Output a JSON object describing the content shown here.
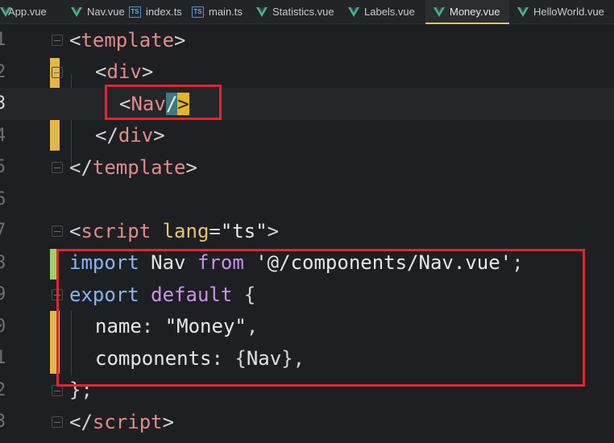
{
  "tabs": [
    {
      "label": "App.vue",
      "icon": "vue-icon",
      "active": false
    },
    {
      "label": "Nav.vue",
      "icon": "vue-icon",
      "active": false
    },
    {
      "label": "index.ts",
      "icon": "ts-icon",
      "active": false
    },
    {
      "label": "main.ts",
      "icon": "ts-icon",
      "active": false
    },
    {
      "label": "Statistics.vue",
      "icon": "vue-icon",
      "active": false
    },
    {
      "label": "Labels.vue",
      "icon": "vue-icon",
      "active": false
    },
    {
      "label": "Money.vue",
      "icon": "vue-icon",
      "active": true
    },
    {
      "label": "HelloWorld.vue",
      "icon": "vue-icon",
      "active": false
    }
  ],
  "ts_badge": "TS",
  "line_numbers": [
    "1",
    "2",
    "3",
    "4",
    "5",
    "6",
    "7",
    "8",
    "9",
    "0",
    "1",
    "2",
    "3"
  ],
  "code": {
    "l1": {
      "open": "<",
      "tag": "template",
      "close": ">"
    },
    "l2": {
      "open": "<",
      "tag": "div",
      "close": ">"
    },
    "l3": {
      "open": "<",
      "tag": "Nav",
      "slash": "/",
      "close": ">"
    },
    "l4": {
      "open": "</",
      "tag": "div",
      "close": ">"
    },
    "l5": {
      "open": "</",
      "tag": "template",
      "close": ">"
    },
    "l7": {
      "open": "<",
      "tag": "script",
      "attr": "lang",
      "eq": "=",
      "value": "\"ts\"",
      "close": ">"
    },
    "l8": {
      "kw": "import",
      "name": "Nav",
      "from": "from",
      "path": "'@/components/Nav.vue'",
      "semi": ";"
    },
    "l9": {
      "kw1": "export",
      "kw2": "default",
      "brace": "{"
    },
    "l10": {
      "prop": "name",
      "colon": ":",
      "value": "\"Money\"",
      "comma": ","
    },
    "l11": {
      "prop": "components",
      "colon": ":",
      "ob": "{",
      "ident": "Nav",
      "cb": "}",
      "comma": ","
    },
    "l12": {
      "text": "};"
    },
    "l13": {
      "open": "</",
      "tag": "script",
      "close": ">"
    }
  },
  "colors": {
    "accent": "#e0c84b",
    "annotation": "#e0262e",
    "change_bar": "#e2b84a"
  }
}
